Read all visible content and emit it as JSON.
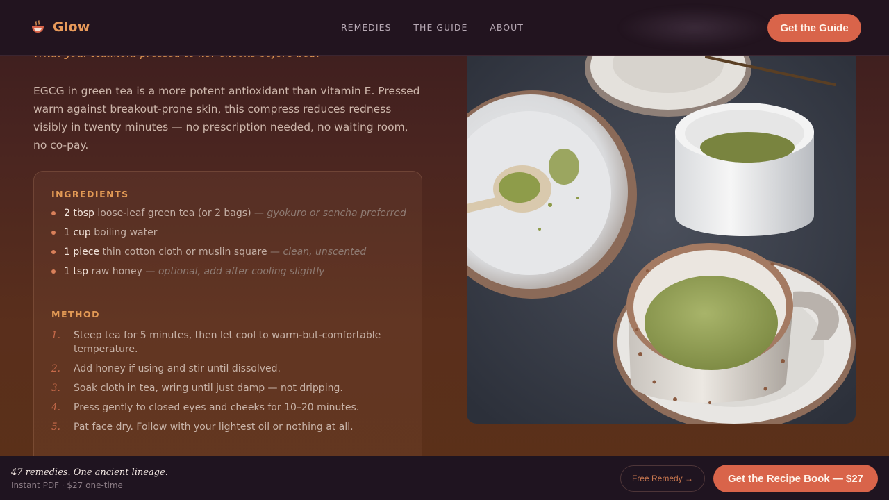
{
  "header": {
    "logo_text": "Glow",
    "logo_icon": "teacup-icon",
    "nav": [
      {
        "label": "REMEDIES"
      },
      {
        "label": "THE GUIDE"
      },
      {
        "label": "ABOUT"
      }
    ],
    "cta_label": "Get the Guide"
  },
  "article": {
    "quote": "What your Halmoni pressed to her cheeks before bed.",
    "intro": "EGCG in green tea is a more potent antioxidant than vitamin E. Pressed warm against breakout-prone skin, this compress reduces redness visibly in twenty minutes — no prescription needed, no waiting room, no co-pay."
  },
  "card": {
    "ingredients_label": "INGREDIENTS",
    "ingredients": [
      {
        "qty": "2 tbsp",
        "name": " loose-leaf green tea (or 2 bags)",
        "note": " — gyokuro or sencha preferred"
      },
      {
        "qty": "1 cup",
        "name": " boiling water",
        "note": ""
      },
      {
        "qty": "1 piece",
        "name": " thin cotton cloth or muslin square",
        "note": " — clean, unscented"
      },
      {
        "qty": "1 tsp",
        "name": " raw honey",
        "note": " — optional, add after cooling slightly"
      }
    ],
    "method_label": "METHOD",
    "method": [
      {
        "num": "1.",
        "text": "Steep tea for 5 minutes, then let cool to warm-but-comfortable temperature."
      },
      {
        "num": "2.",
        "text": "Add honey if using and stir until dissolved."
      },
      {
        "num": "3.",
        "text": "Soak cloth in tea, wring until just damp — not dripping."
      },
      {
        "num": "4.",
        "text": "Press gently to closed eyes and cheeks for 10–20 minutes."
      },
      {
        "num": "5.",
        "text": "Pat face dry. Follow with your lightest oil or nothing at all."
      }
    ]
  },
  "bottom_bar": {
    "tagline": "47 remedies. One ancient lineage.",
    "subline": "Instant PDF · $27 one-time",
    "free_label": "Free Remedy →",
    "buy_label": "Get the Recipe Book — $27"
  },
  "colors": {
    "accent": "#d9644a",
    "highlight": "#e39a55",
    "header_bg": "#22141f"
  }
}
